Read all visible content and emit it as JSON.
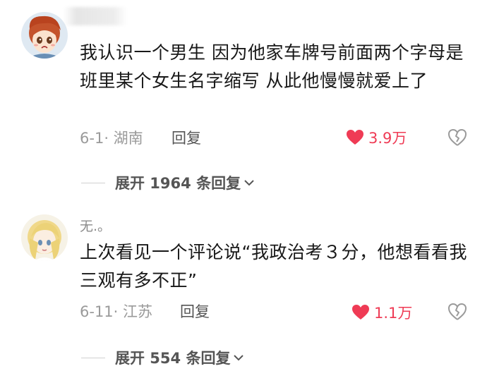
{
  "comments": [
    {
      "username": "",
      "content": "我认识一个男生 因为他家车牌号前面两个字母是班里某个女生名字缩写 从此他慢慢就爱上了",
      "date": "6-1",
      "location": "湖南",
      "reply_label": "回复",
      "likes": "3.9万",
      "expand_text": "展开 1964 条回复"
    },
    {
      "username": "无.。",
      "content": "上次看见一个评论说“我政治考３分，他想看看我三观有多不正”",
      "date": "6-11",
      "location": "江苏",
      "reply_label": "回复",
      "likes": "1.1万",
      "expand_text": "展开 554 条回复"
    }
  ],
  "icons": {
    "like": "heart-icon",
    "dislike": "broken-heart-icon",
    "expand": "chevron-down-icon"
  },
  "colors": {
    "like": "#ef3b55",
    "meta": "#9a9a9a"
  }
}
